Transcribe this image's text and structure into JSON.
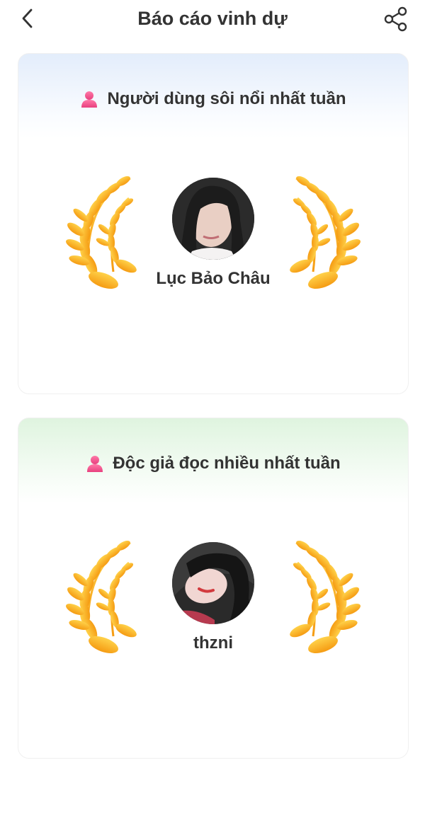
{
  "header": {
    "title": "Báo cáo vinh dự",
    "back_icon": "chevron-left-icon",
    "share_icon": "share-icon"
  },
  "cards": [
    {
      "title": "Người dùng sôi nổi nhất tuần",
      "icon": "person-icon",
      "user": {
        "name": "Lục Bảo Châu"
      },
      "header_color": "#e3edfb"
    },
    {
      "title": "Độc giả đọc nhiều nhất tuần",
      "icon": "person-icon",
      "user": {
        "name": "thzni"
      },
      "header_color": "#dff4df"
    }
  ],
  "colors": {
    "laurel_light": "#ffd24a",
    "laurel_dark": "#f59b12",
    "person_icon": "#f0508c"
  }
}
